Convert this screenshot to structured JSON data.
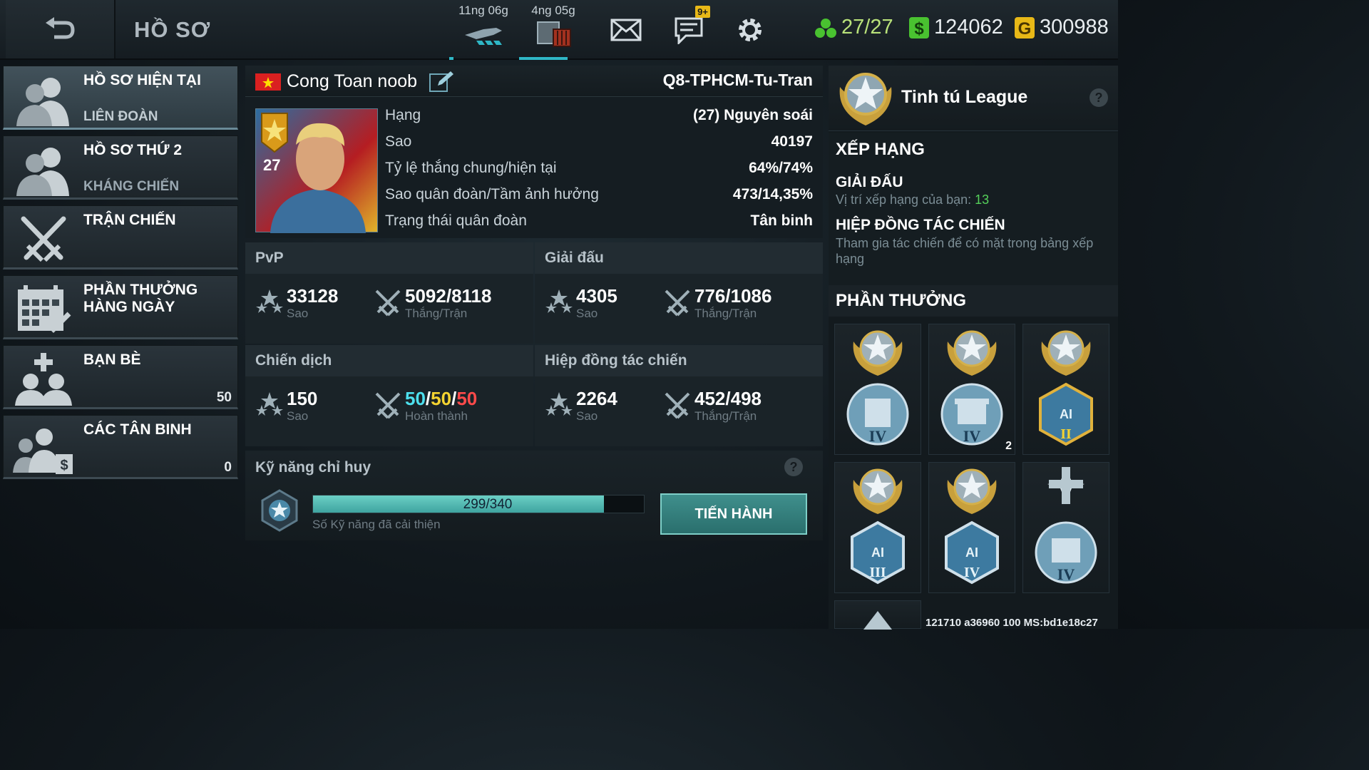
{
  "topbar": {
    "title": "HỒ SƠ",
    "timer1": "11ng 06g",
    "timer2": "4ng 05g",
    "chat_badge": "9+",
    "energy": "27/27",
    "cash": "124062",
    "gold": "300988"
  },
  "menu": [
    {
      "title": "HỒ SƠ HIỆN TẠI",
      "sub": "LIÊN ĐOÀN",
      "count": "",
      "icon": "profile-icon"
    },
    {
      "title": "HỒ SƠ THỨ 2",
      "sub": "KHÁNG CHIẾN",
      "count": "",
      "icon": "profile-icon"
    },
    {
      "title": "TRẬN CHIẾN",
      "sub": "",
      "count": "",
      "icon": "crossed-swords-icon"
    },
    {
      "title": "PHẦN THƯỞNG HÀNG NGÀY",
      "sub": "",
      "count": "",
      "icon": "calendar-check-icon"
    },
    {
      "title": "BẠN BÈ",
      "sub": "",
      "count": "50",
      "icon": "add-friend-icon"
    },
    {
      "title": "CÁC TÂN BINH",
      "sub": "",
      "count": "0",
      "icon": "recruits-icon"
    }
  ],
  "profile": {
    "name": "Cong Toan noob",
    "clan": "Q8-TPHCM-Tu-Tran",
    "level": "27",
    "stats": [
      {
        "k": "Hạng",
        "v": "(27) Nguyên soái"
      },
      {
        "k": "Sao",
        "v": "40197"
      },
      {
        "k": "Tỷ lệ thắng chung/hiện tại",
        "v": "64%/74%"
      },
      {
        "k": "Sao quân đoàn/Tầm ảnh hưởng",
        "v": "473/14,35%"
      },
      {
        "k": "Trạng thái quân đoàn",
        "v": "Tân binh"
      }
    ]
  },
  "sections": {
    "pvp": {
      "title": "PvP",
      "stars": "33128",
      "stars_cap": "Sao",
      "wins": "5092/8118",
      "wins_cap": "Thắng/Trận"
    },
    "tournament": {
      "title": "Giải đấu",
      "stars": "4305",
      "stars_cap": "Sao",
      "wins": "776/1086",
      "wins_cap": "Thắng/Trận"
    },
    "campaign": {
      "title": "Chiến dịch",
      "stars": "150",
      "stars_cap": "Sao",
      "c1": "50",
      "c2": "50",
      "c3": "50",
      "wins_cap": "Hoàn thành"
    },
    "contract": {
      "title": "Hiệp đồng tác chiến",
      "stars": "2264",
      "stars_cap": "Sao",
      "wins": "452/498",
      "wins_cap": "Thắng/Trận"
    }
  },
  "skills": {
    "title": "Kỹ năng chỉ huy",
    "progress_text": "299/340",
    "progress_value": 299,
    "progress_max": 340,
    "caption": "Số Kỹ năng đã cải thiện",
    "button": "TIẾN HÀNH"
  },
  "right": {
    "league": "Tinh tú League",
    "ranking": "XẾP HẠNG",
    "tournament_title": "GIẢI ĐẤU",
    "tournament_sub": "Vị trí xếp hạng của bạn:",
    "tournament_rank": "13",
    "contract_title": "HIỆP ĐỒNG TÁC CHIẾN",
    "contract_sub": "Tham gia tác chiến để có mặt trong bảng xếp hạng",
    "rewards_title": "PHẦN THƯỞNG",
    "reward_badge_count": "2",
    "footer": "121710 a36960 100 MS:bd1e18c27"
  },
  "colors": {
    "accent": "#2fb7c6",
    "green": "#49c230",
    "gold": "#e8b817",
    "red": "#ff4a4a",
    "yellow": "#f3d331",
    "cyan": "#4de0ee"
  }
}
